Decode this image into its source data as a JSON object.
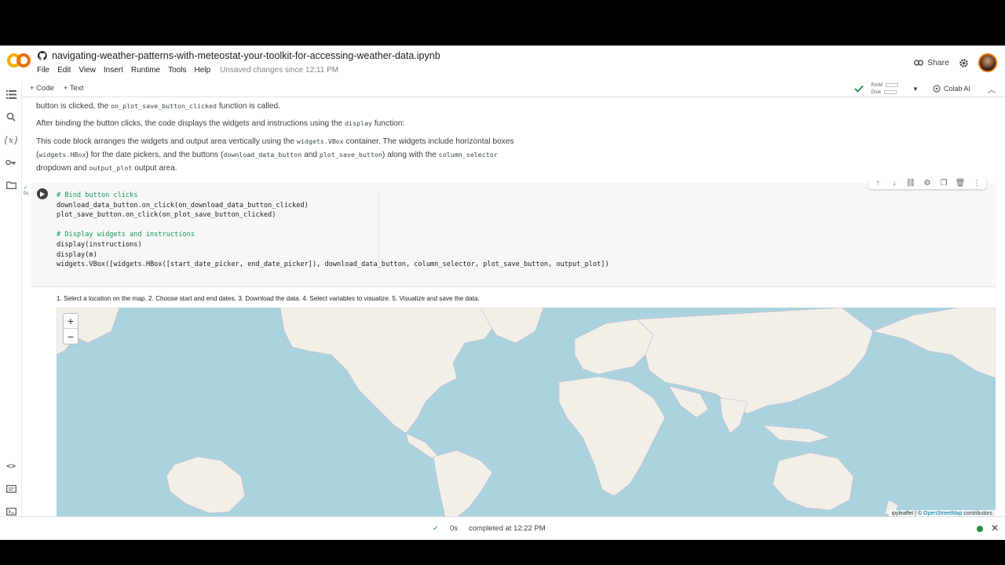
{
  "header": {
    "notebook_title": "navigating-weather-patterns-with-meteostat-your-toolkit-for-accessing-weather-data.ipynb",
    "menus": [
      "File",
      "Edit",
      "View",
      "Insert",
      "Runtime",
      "Tools",
      "Help"
    ],
    "unsaved": "Unsaved changes since 12:11 PM",
    "share_label": "Share"
  },
  "toolbar": {
    "code_label": "+ Code",
    "text_label": "+ Text",
    "ram_label": "RAM",
    "disk_label": "Disk",
    "colab_ai_label": "Colab AI"
  },
  "text": {
    "p1_a": "button is clicked, the ",
    "p1_code": "on_plot_save_button_clicked",
    "p1_b": " function is called.",
    "p2_a": "After binding the button clicks, the code displays the widgets and instructions using the ",
    "p2_code": "display",
    "p2_b": " function:",
    "p3_a": "This code block arranges the widgets and output area vertically using the ",
    "p3_code1": "widgets.VBox",
    "p3_b": " container. The widgets include horizontal boxes",
    "p3_c": "(",
    "p3_code2": "widgets.HBox",
    "p3_d": ") for the date pickers, and the buttons (",
    "p3_code3": "download_data_button",
    "p3_e": " and ",
    "p3_code4": "plot_save_button",
    "p3_f": ") along with the ",
    "p3_code5": "column_selector",
    "p4_a": "dropdown and ",
    "p4_code": "output_plot",
    "p4_b": " output area."
  },
  "cell": {
    "exec_time": "0s",
    "lines": [
      {
        "text": "# Bind button clicks",
        "comment": true
      },
      {
        "text": "download_data_button.on_click(on_download_data_button_clicked)",
        "comment": false
      },
      {
        "text": "plot_save_button.on_click(on_plot_save_button_clicked)",
        "comment": false
      },
      {
        "text": "",
        "comment": false
      },
      {
        "text": "# Display widgets and instructions",
        "comment": true
      },
      {
        "text": "display(instructions)",
        "comment": false
      },
      {
        "text": "display(m)",
        "comment": false
      },
      {
        "text": "widgets.VBox([widgets.HBox([start_date_picker, end_date_picker]), download_data_button, column_selector, plot_save_button, output_plot])",
        "comment": false
      }
    ]
  },
  "output": {
    "instructions": "1. Select a location on the map. 2. Choose start and end dates. 3. Download the data. 4. Select variables to visualize. 5. Visualize and save the data.",
    "zoom_in": "+",
    "zoom_out": "−",
    "attribution_a": "ipyleaflet | © ",
    "attribution_link": "OpenStreetMap",
    "attribution_b": " contributors"
  },
  "status": {
    "time": "0s",
    "completed": "completed at 12:22 PM"
  },
  "colors": {
    "ocean": "#aad3df",
    "land": "#f2efe9",
    "accent_orange": "#f9ab00",
    "status_green": "#1e8e3e"
  }
}
